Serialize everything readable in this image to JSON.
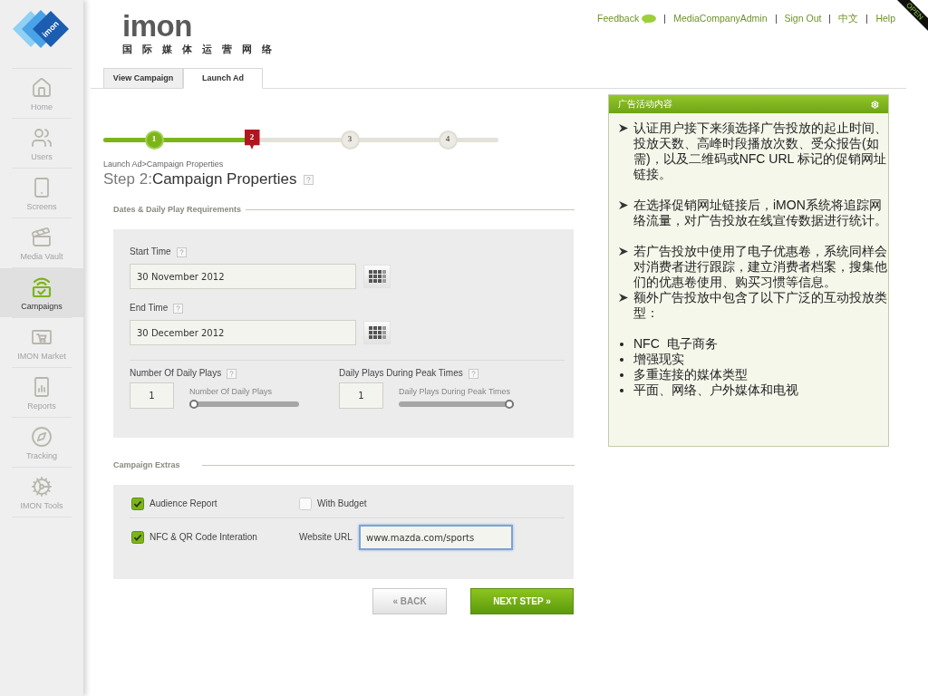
{
  "sidebar": {
    "logo_text": "imon",
    "items": [
      {
        "label": "Home",
        "selected": false
      },
      {
        "label": "Users",
        "selected": false
      },
      {
        "label": "Screens",
        "selected": false
      },
      {
        "label": "Media Vault",
        "selected": false
      },
      {
        "label": "Campaigns",
        "selected": true
      },
      {
        "label": "IMON Market",
        "selected": false
      },
      {
        "label": "Reports",
        "selected": false
      },
      {
        "label": "Tracking",
        "selected": false
      },
      {
        "label": "IMON Tools",
        "selected": false
      }
    ]
  },
  "header": {
    "logo": "imon",
    "tagline": "国 际 媒 体 运 营 网 络",
    "links": [
      "Feedback",
      "MediaCompanyAdmin",
      "Sign Out",
      "中文",
      "Help"
    ]
  },
  "ribbon": "OPEN",
  "tabs": [
    {
      "label": "View Campaign",
      "selected": false
    },
    {
      "label": "Launch Ad",
      "selected": true
    }
  ],
  "stepper": {
    "steps": [
      {
        "label": "1",
        "completed": true,
        "selected": false
      },
      {
        "label": "2",
        "completed": false,
        "selected": true
      },
      {
        "label": "3",
        "completed": false,
        "selected": false
      },
      {
        "label": "4",
        "completed": false,
        "selected": false
      }
    ]
  },
  "breadcrumb": "Launch Ad>Campaign Properties",
  "title": {
    "step": "Step 2:",
    "name": "Campaign Properties"
  },
  "dates_section": {
    "heading": "Dates & Daily Play Requirements",
    "date_fields": [
      {
        "label": "Start Time",
        "value": "30 November 2012"
      },
      {
        "label": "End Time",
        "value": "30 December 2012"
      }
    ],
    "play_fields": [
      {
        "label": "Number Of Daily Plays",
        "value": "1",
        "slider_label": "Number Of Daily Plays",
        "level": 0
      },
      {
        "label": "Daily Plays During Peak Times",
        "value": "1",
        "slider_label": "Daily Plays During Peak Times",
        "level": 1
      }
    ]
  },
  "extras_section": {
    "heading": "Campaign Extras",
    "rows": [
      {
        "items": [
          {
            "kind": "checkbox",
            "label": "Audience Report",
            "checked": true
          },
          {
            "kind": "checkbox",
            "label": "With Budget",
            "checked": false
          }
        ]
      },
      {
        "items": [
          {
            "kind": "checkbox",
            "label": "NFC & QR Code Interation",
            "checked": true
          },
          {
            "kind": "url",
            "label": "Website URL",
            "value": "www.mazda.com/sports",
            "focused": true
          }
        ]
      }
    ]
  },
  "buttons": [
    {
      "label": "« BACK",
      "kind": "secondary"
    },
    {
      "label": "NEXT STEP »",
      "kind": "primary"
    }
  ],
  "info_panel": {
    "title": "广告活动内容",
    "sections": [
      {
        "items": [
          {
            "kind": "arrow",
            "text": "认证用户接下来须选择广告投放的起止时间、投放天数、高峰时段播放次数、受众报告(如需)，以及二维码或NFC URL 标记的促销网址链接。"
          }
        ]
      },
      {
        "items": [
          {
            "kind": "arrow",
            "text": "在选择促销网址链接后，iMON系统将追踪网络流量，对广告投放在线宣传数据进行统计。"
          }
        ]
      },
      {
        "items": [
          {
            "kind": "arrow",
            "text": "若广告投放中使用了电子优惠卷，系统同样会对消费者进行跟踪，建立消费者档案，搜集他们的优惠卷使用、购买习惯等信息。"
          },
          {
            "kind": "arrow",
            "text": "额外广告投放中包含了以下广泛的互动投放类型："
          }
        ]
      },
      {
        "items": [
          {
            "kind": "bullet",
            "text": "NFC  电子商务"
          },
          {
            "kind": "bullet",
            "text": "增强现实"
          },
          {
            "kind": "bullet",
            "text": "多重连接的媒体类型"
          },
          {
            "kind": "bullet",
            "text": "平面、网络、户外媒体和电视"
          }
        ]
      }
    ]
  }
}
